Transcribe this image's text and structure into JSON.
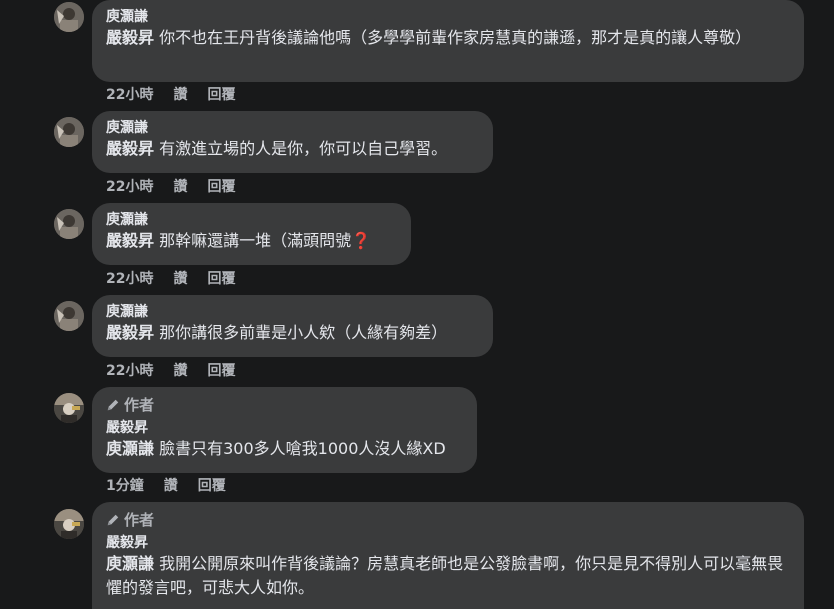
{
  "comments": [
    {
      "author": "庾灝謙",
      "mention": "嚴毅昇",
      "text": "你不也在王丹背後議論他嗎（多學學前輩作家房慧真的謙遜，那才是真的讓人尊敬）",
      "time": "22小時",
      "like": "讚",
      "reply": "回覆"
    },
    {
      "author": "庾灝謙",
      "mention": "嚴毅昇",
      "text": "有激進立場的人是你，你可以自己學習。",
      "time": "22小時",
      "like": "讚",
      "reply": "回覆"
    },
    {
      "author": "庾灝謙",
      "mention": "嚴毅昇",
      "text": "那幹嘛還講一堆（滿頭問號",
      "emoji": "❓",
      "time": "22小時",
      "like": "讚",
      "reply": "回覆"
    },
    {
      "author": "庾灝謙",
      "mention": "嚴毅昇",
      "text": "那你講很多前輩是小人欸（人緣有夠差）",
      "time": "22小時",
      "like": "讚",
      "reply": "回覆"
    },
    {
      "badge": "作者",
      "author": "嚴毅昇",
      "mention": "庾灝謙",
      "text": "臉書只有300多人嗆我1000人沒人緣XD",
      "time": "1分鐘",
      "like": "讚",
      "reply": "回覆"
    },
    {
      "badge": "作者",
      "author": "嚴毅昇",
      "mention": "庾灝謙",
      "text": "我開公開原來叫作背後議論？房慧真老師也是公發臉書啊，你只是見不得別人可以毫無畏懼的發言吧，可悲大人如你。"
    }
  ]
}
